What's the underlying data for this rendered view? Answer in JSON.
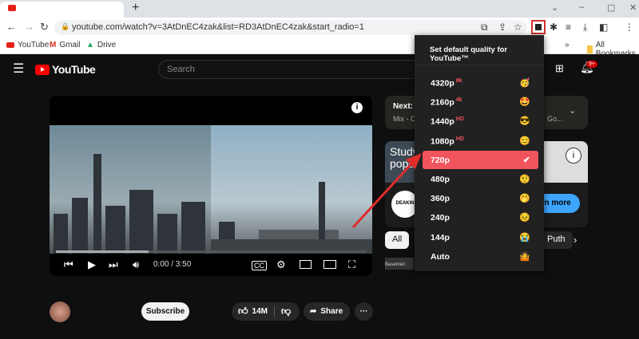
{
  "browser": {
    "new_tab": "+",
    "url": "youtube.com/watch?v=3AtDnEC4zak&list=RD3AtDnEC4zak&start_radio=1",
    "bookmarks": [
      {
        "label": "YouTube",
        "icon": "youtube-icon"
      },
      {
        "label": "Gmail",
        "icon": "gmail-icon"
      },
      {
        "label": "Drive",
        "icon": "drive-icon"
      }
    ],
    "all_bookmarks": "All Bookmarks",
    "overflow": "»"
  },
  "youtube": {
    "logo": "YouTube",
    "search_placeholder": "Search",
    "notification_count": "9+",
    "player": {
      "time": "0:00 / 3:50",
      "progress": 0.3
    },
    "next": {
      "label": "Next: H",
      "sub": "Mix - Ch",
      "sub_tail": "Go..."
    },
    "ad": {
      "title1": "Study",
      "title2": "popu",
      "brand": "DEAKIN",
      "brand_sub": "UNIVERSITY",
      "cta": "arn more"
    },
    "chips": [
      "All",
      "Puth"
    ],
    "bottom_thumb": "Basemen",
    "subscribe": "Subscribe",
    "likes": "14M",
    "share": "Share",
    "more": "···"
  },
  "popup": {
    "title": "Set default quality for YouTube™",
    "accent": "#f0545c",
    "options": [
      {
        "label": "4320p",
        "tag": "8k",
        "emoji": "🥳"
      },
      {
        "label": "2160p",
        "tag": "4k",
        "emoji": "🤩"
      },
      {
        "label": "1440p",
        "tag": "HD",
        "emoji": "😎"
      },
      {
        "label": "1080p",
        "tag": "HD",
        "emoji": "😊"
      },
      {
        "label": "720p",
        "tag": "",
        "emoji": "✔",
        "selected": true
      },
      {
        "label": "480p",
        "tag": "",
        "emoji": "🤨"
      },
      {
        "label": "360p",
        "tag": "",
        "emoji": "🤭"
      },
      {
        "label": "240p",
        "tag": "",
        "emoji": "😣"
      },
      {
        "label": "144p",
        "tag": "",
        "emoji": "😭"
      },
      {
        "label": "Auto",
        "tag": "",
        "emoji": "🤷"
      }
    ]
  }
}
